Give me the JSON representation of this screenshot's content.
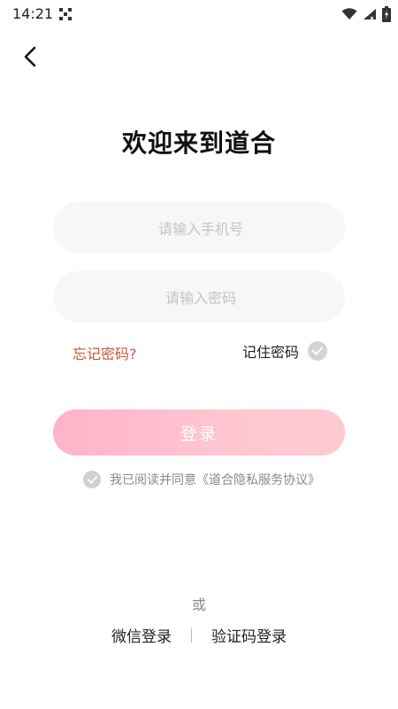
{
  "status_bar": {
    "time": "14:21"
  },
  "icons": {
    "back": "chevron-left-icon",
    "wifi": "wifi-icon",
    "signal": "signal-icon",
    "battery": "battery-charging-icon",
    "qr": "qr-code-icon",
    "check": "check-icon"
  },
  "title": "欢迎来到道合",
  "form": {
    "phone_placeholder": "请输入手机号",
    "password_placeholder": "请输入密码",
    "forgot_label": "忘记密码?",
    "remember_label": "记住密码",
    "login_label": "登录"
  },
  "agreement": {
    "prefix": "我已阅读并同意",
    "link": "《道合隐私服务协议》"
  },
  "alternatives": {
    "or_label": "或",
    "wechat_label": "微信登录",
    "code_label": "验证码登录"
  },
  "colors": {
    "accent": "#ffb3c8",
    "forgot": "#c8543c",
    "input_bg": "#f7f7f7",
    "check_bg": "#d4d4d4"
  }
}
